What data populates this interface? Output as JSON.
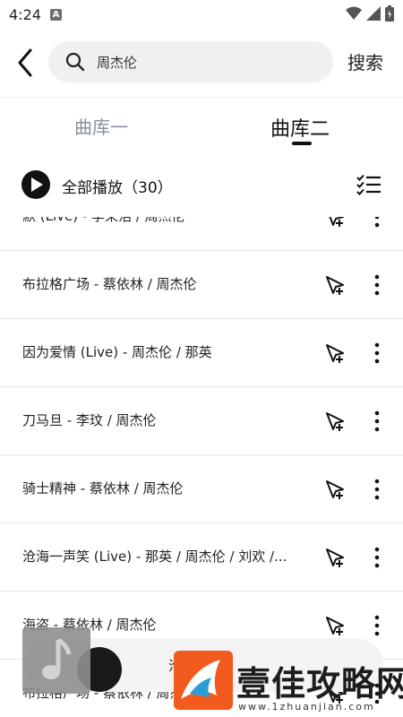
{
  "status_bar": {
    "time": "4:24",
    "notification_letter": "A"
  },
  "search": {
    "query": "周杰伦",
    "search_label": "搜索"
  },
  "tabs": [
    {
      "label": "曲库一",
      "active": false
    },
    {
      "label": "曲库二",
      "active": true
    }
  ],
  "play_all": {
    "label": "全部播放（30）"
  },
  "songs": [
    {
      "title": "默 (Live) - 李荣浩 / 周杰伦"
    },
    {
      "title": "布拉格广场 - 蔡依林 / 周杰伦"
    },
    {
      "title": "因为爱情 (Live) - 周杰伦 / 那英"
    },
    {
      "title": "刀马旦 - 李玟 / 周杰伦"
    },
    {
      "title": "骑士精神 - 蔡依林 / 周杰伦"
    },
    {
      "title": "沧海一声笑 (Live) - 那英 / 周杰伦 / 刘欢 /..."
    },
    {
      "title": "海盗 - 蔡依林 / 周杰伦"
    },
    {
      "title": "布拉格广场 - 蔡依林 / 周杰伦"
    }
  ],
  "mini_player": {
    "title": "沧"
  },
  "watermark": {
    "text": "壹佳攻略网",
    "url": "www.1zhuanjian.com"
  },
  "icons": {
    "back": "back-arrow-icon",
    "search": "search-icon",
    "play": "play-icon",
    "multi_select": "checklist-icon",
    "add": "add-to-playlist-icon",
    "more": "more-vertical-icon"
  },
  "colors": {
    "inactive_tab": "#8a9099",
    "search_bg": "#f0f0f0",
    "watermark_orange": "#f25a1e"
  }
}
